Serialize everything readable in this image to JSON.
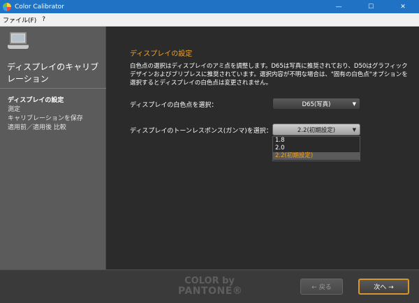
{
  "window": {
    "title": "Color Calibrator",
    "controls": {
      "minimize": "—",
      "maximize": "☐",
      "close": "✕"
    }
  },
  "menu": {
    "items": [
      "ファイル(F)",
      "?"
    ]
  },
  "sidebar": {
    "title": "ディスプレイのキャリブレーション",
    "steps": [
      {
        "label": "ディスプレイの設定",
        "active": true
      },
      {
        "label": "測定",
        "active": false
      },
      {
        "label": "キャリブレーションを保存",
        "active": false
      },
      {
        "label": "適用前／適用後 比較",
        "active": false
      }
    ]
  },
  "main": {
    "section_title": "ディスプレイの設定",
    "description": "白色点の選択はディスプレイのアミ点を調整します。D65は写真に推奨されており、D50はグラフィックデザインおよびブリプレスに推奨されています。選択内容が不明な場合は、\"固有の白色点\"オプションを選択するとディスプレイの白色点は変更されません。",
    "white_point": {
      "label": "ディスプレイの白色点を選択：",
      "value": "D65(写真)"
    },
    "gamma": {
      "label": "ディスプレイのトーンレスポンス(ガンマ)を選択：",
      "value": "2.2(初期設定)",
      "options": [
        "1.8",
        "2.0",
        "2.2(初期設定)"
      ],
      "selected_index": 2
    }
  },
  "footer": {
    "brand_line1": "COLOR by",
    "brand_line2": "PANTONE®",
    "back_label": "← 戻る",
    "next_label": "次へ →"
  },
  "colors": {
    "accent": "#f0a32a",
    "titlebar": "#1f72c4",
    "sidebar": "#5b5b5b",
    "main_bg": "#2b2b2b"
  }
}
